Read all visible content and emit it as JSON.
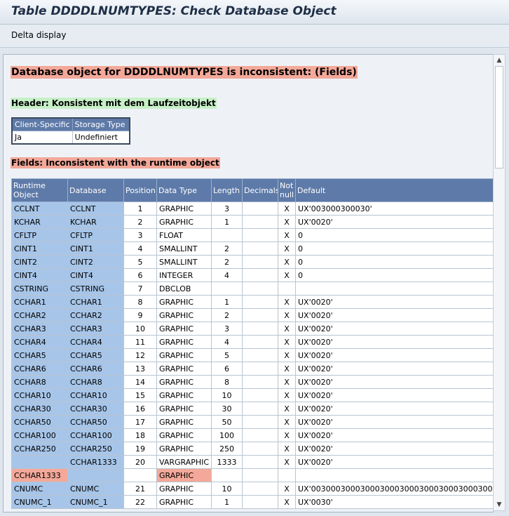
{
  "window": {
    "title": "Table DDDDLNUMTYPES: Check Database Object"
  },
  "toolbar": {
    "delta_display": "Delta display"
  },
  "messages": {
    "main": "Database object for DDDDLNUMTYPES is inconsistent: (Fields)",
    "header": "Header: Konsistent mit dem Laufzeitobjekt",
    "fields": "Fields: Inconsistent with the runtime object"
  },
  "header_table": {
    "columns": [
      "Client-Specific",
      "Storage Type"
    ],
    "row": [
      "Ja",
      "Undefiniert"
    ]
  },
  "fields_table": {
    "columns": [
      "Runtime Object",
      "Database",
      "Position",
      "Data Type",
      "Length",
      "Decimals",
      "Not null",
      "Default"
    ],
    "rows": [
      [
        "CCLNT",
        "CCLNT",
        "1",
        "GRAPHIC",
        "3",
        "",
        "X",
        "UX'003000300030'"
      ],
      [
        "KCHAR",
        "KCHAR",
        "2",
        "GRAPHIC",
        "1",
        "",
        "X",
        "UX'0020'"
      ],
      [
        "CFLTP",
        "CFLTP",
        "3",
        "FLOAT",
        "",
        "",
        "X",
        "0"
      ],
      [
        "CINT1",
        "CINT1",
        "4",
        "SMALLINT",
        "2",
        "",
        "X",
        "0"
      ],
      [
        "CINT2",
        "CINT2",
        "5",
        "SMALLINT",
        "2",
        "",
        "X",
        "0"
      ],
      [
        "CINT4",
        "CINT4",
        "6",
        "INTEGER",
        "4",
        "",
        "X",
        "0"
      ],
      [
        "CSTRING",
        "CSTRING",
        "7",
        "DBCLOB",
        "",
        "",
        "",
        ""
      ],
      [
        "CCHAR1",
        "CCHAR1",
        "8",
        "GRAPHIC",
        "1",
        "",
        "X",
        "UX'0020'"
      ],
      [
        "CCHAR2",
        "CCHAR2",
        "9",
        "GRAPHIC",
        "2",
        "",
        "X",
        "UX'0020'"
      ],
      [
        "CCHAR3",
        "CCHAR3",
        "10",
        "GRAPHIC",
        "3",
        "",
        "X",
        "UX'0020'"
      ],
      [
        "CCHAR4",
        "CCHAR4",
        "11",
        "GRAPHIC",
        "4",
        "",
        "X",
        "UX'0020'"
      ],
      [
        "CCHAR5",
        "CCHAR5",
        "12",
        "GRAPHIC",
        "5",
        "",
        "X",
        "UX'0020'"
      ],
      [
        "CCHAR6",
        "CCHAR6",
        "13",
        "GRAPHIC",
        "6",
        "",
        "X",
        "UX'0020'"
      ],
      [
        "CCHAR8",
        "CCHAR8",
        "14",
        "GRAPHIC",
        "8",
        "",
        "X",
        "UX'0020'"
      ],
      [
        "CCHAR10",
        "CCHAR10",
        "15",
        "GRAPHIC",
        "10",
        "",
        "X",
        "UX'0020'"
      ],
      [
        "CCHAR30",
        "CCHAR30",
        "16",
        "GRAPHIC",
        "30",
        "",
        "X",
        "UX'0020'"
      ],
      [
        "CCHAR50",
        "CCHAR50",
        "17",
        "GRAPHIC",
        "50",
        "",
        "X",
        "UX'0020'"
      ],
      [
        "CCHAR100",
        "CCHAR100",
        "18",
        "GRAPHIC",
        "100",
        "",
        "X",
        "UX'0020'"
      ],
      [
        "CCHAR250",
        "CCHAR250",
        "19",
        "GRAPHIC",
        "250",
        "",
        "X",
        "UX'0020'"
      ],
      [
        "",
        "CCHAR1333",
        "20",
        "VARGRAPHIC",
        "1333",
        "",
        "X",
        "UX'0020'"
      ],
      [
        "CCHAR1333",
        "",
        "",
        "GRAPHIC",
        "",
        "",
        "",
        ""
      ],
      [
        "CNUMC",
        "CNUMC",
        "21",
        "GRAPHIC",
        "10",
        "",
        "X",
        "UX'00300030003000300030003000300030003000"
      ],
      [
        "CNUMC_1",
        "CNUMC_1",
        "22",
        "GRAPHIC",
        "1",
        "",
        "X",
        "UX'0030'"
      ]
    ],
    "red_rows": [
      20
    ]
  },
  "scrollbar": {
    "up_glyph": "▲",
    "down_glyph": "▼"
  },
  "colors": {
    "error": "#f3a899",
    "ok": "#c7f0c7",
    "key": "#a7c5e8",
    "header": "#5e7aa8"
  }
}
